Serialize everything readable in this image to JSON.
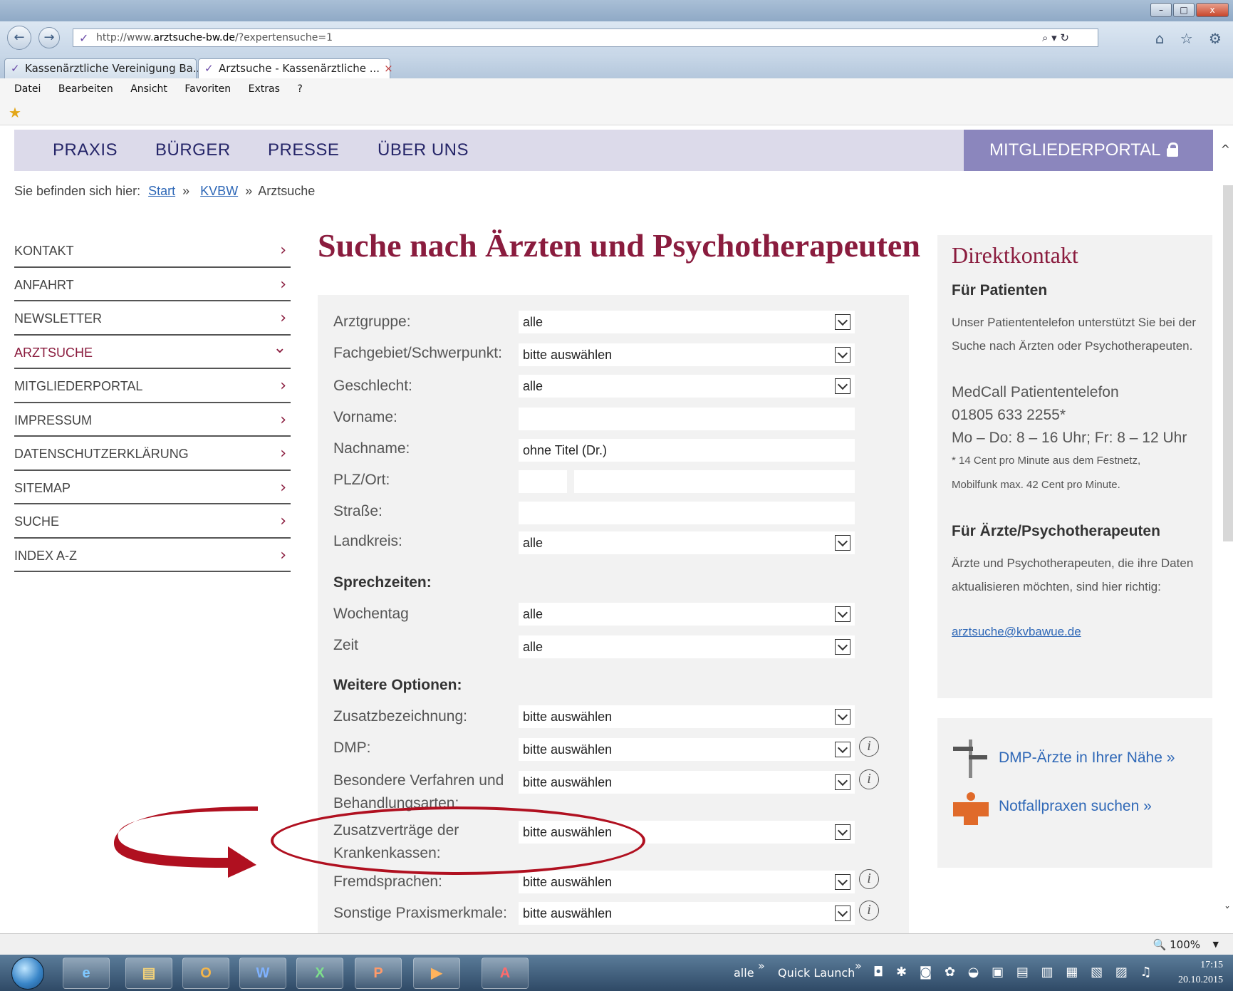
{
  "window": {
    "minimize": "–",
    "maximize": "□",
    "close": "x"
  },
  "address": {
    "back": "←",
    "forward": "→",
    "url_prefix": "http://www.",
    "url_host": "arztsuche-bw.de",
    "url_path": "/?expertensuche=1",
    "search_tools": "⌕ ▾ ↻"
  },
  "chrome_icons": "⌂ ☆ ⚙",
  "tabs": [
    {
      "label": "Kassenärztliche Vereinigung Ba..."
    },
    {
      "label": "Arztsuche - Kassenärztliche ...",
      "close": "×"
    }
  ],
  "menubar": [
    "Datei",
    "Bearbeiten",
    "Ansicht",
    "Favoriten",
    "Extras",
    "?"
  ],
  "topnav": {
    "items": [
      "PRAXIS",
      "BÜRGER",
      "PRESSE",
      "ÜBER UNS"
    ],
    "portal": "MITGLIEDERPORTAL"
  },
  "breadcrumb": {
    "prefix": "Sie befinden sich hier:",
    "links": [
      "Start",
      "KVBW"
    ],
    "sep": "»",
    "current": "Arztsuche"
  },
  "leftmenu": [
    {
      "label": "KONTAKT",
      "chev": "›"
    },
    {
      "label": "ANFAHRT",
      "chev": "›"
    },
    {
      "label": "NEWSLETTER",
      "chev": "›"
    },
    {
      "label": "ARZTSUCHE",
      "chev": "⌄"
    },
    {
      "label": "MITGLIEDERPORTAL",
      "chev": "›"
    },
    {
      "label": "IMPRESSUM",
      "chev": "›"
    },
    {
      "label": "DATENSCHUTZERKLÄRUNG",
      "chev": "›"
    },
    {
      "label": "SITEMAP",
      "chev": "›"
    },
    {
      "label": "SUCHE",
      "chev": "›"
    },
    {
      "label": "INDEX A-Z",
      "chev": "›"
    }
  ],
  "main": {
    "title": "Suche nach Ärzten und Psychotherapeuten",
    "form": {
      "arztgruppe": {
        "label": "Arztgruppe:",
        "value": "alle"
      },
      "fachgebiet": {
        "label": "Fachgebiet/Schwerpunkt:",
        "value": "bitte auswählen"
      },
      "geschlecht": {
        "label": "Geschlecht:",
        "value": "alle"
      },
      "vorname": {
        "label": "Vorname:",
        "value": ""
      },
      "nachname": {
        "label": "Nachname:",
        "value": "ohne Titel (Dr.)"
      },
      "plzort": {
        "label": "PLZ/Ort:",
        "plz": "",
        "ort": ""
      },
      "strasse": {
        "label": "Straße:",
        "value": ""
      },
      "landkreis": {
        "label": "Landkreis:",
        "value": "alle"
      },
      "sprechzeiten_heading": "Sprechzeiten:",
      "wochentag": {
        "label": "Wochentag",
        "value": "alle"
      },
      "zeit": {
        "label": "Zeit",
        "value": "alle"
      },
      "weitere_heading": "Weitere Optionen:",
      "zusatzbezeichnung": {
        "label": "Zusatzbezeichnung:",
        "value": "bitte auswählen"
      },
      "dmp": {
        "label": "DMP:",
        "value": "bitte auswählen"
      },
      "besondere": {
        "label_line1": "Besondere Verfahren und",
        "label_line2": "Behandlungsarten:",
        "value": "bitte auswählen"
      },
      "zusatzvertraege": {
        "label_line1": "Zusatzverträge der",
        "label_line2": "Krankenkassen:",
        "value": "bitte auswählen"
      },
      "fremdsprachen": {
        "label": "Fremdsprachen:",
        "value": "bitte auswählen"
      },
      "sonstige": {
        "label": "Sonstige Praxismerkmale:",
        "value": "bitte auswählen"
      },
      "info_glyph": "i"
    }
  },
  "direktkontakt": {
    "title": "Direktkontakt",
    "patienten_heading": "Für Patienten",
    "patienten_text": "Unser Patiententelefon unterstützt Sie bei der Suche nach Ärzten oder Psychotherapeuten.",
    "medcall": "MedCall Patiententelefon",
    "phone": "01805 633 2255*",
    "hours": "Mo – Do: 8 – 16 Uhr; Fr: 8 – 12 Uhr",
    "note1": "* 14 Cent pro Minute aus dem Festnetz,",
    "note2": "Mobilfunk max. 42 Cent pro Minute.",
    "aerzte_heading": "Für Ärzte/Psychotherapeuten",
    "aerzte_text": "Ärzte und Psychotherapeuten, die ihre Daten aktualisieren möchten, sind hier richtig:",
    "email": "arztsuche@kvbawue.de"
  },
  "quicklinks": {
    "dmp": "DMP-Ärzte in Ihrer Nähe »",
    "notfall": "Notfallpraxen suchen »"
  },
  "scroll": {
    "up": "^",
    "down": "ˇ"
  },
  "statusbar": {
    "zoom": "🔍 100%",
    "zoom_drop": "▼"
  },
  "taskbar": {
    "apps": [
      "e",
      "▤",
      "O",
      "W",
      "X",
      "P",
      "▶",
      "A"
    ],
    "tray_alle": "alle",
    "tray_chevron1": "»",
    "quick_launch": "Quick Launch",
    "tray_chevron2": "»",
    "tray_icons": "◘ ✱ ◙ ✿ ◒ ▣ ▤ ▥ ▦ ▧ ▨ ♫",
    "time": "17:15",
    "date": "20.10.2015"
  },
  "colors": {
    "brand_red": "#8a1c3e",
    "nav_bg": "#dcdaea",
    "portal_bg": "#8b86bd",
    "link_blue": "#2f68b7",
    "annotation_red": "#b01020"
  }
}
